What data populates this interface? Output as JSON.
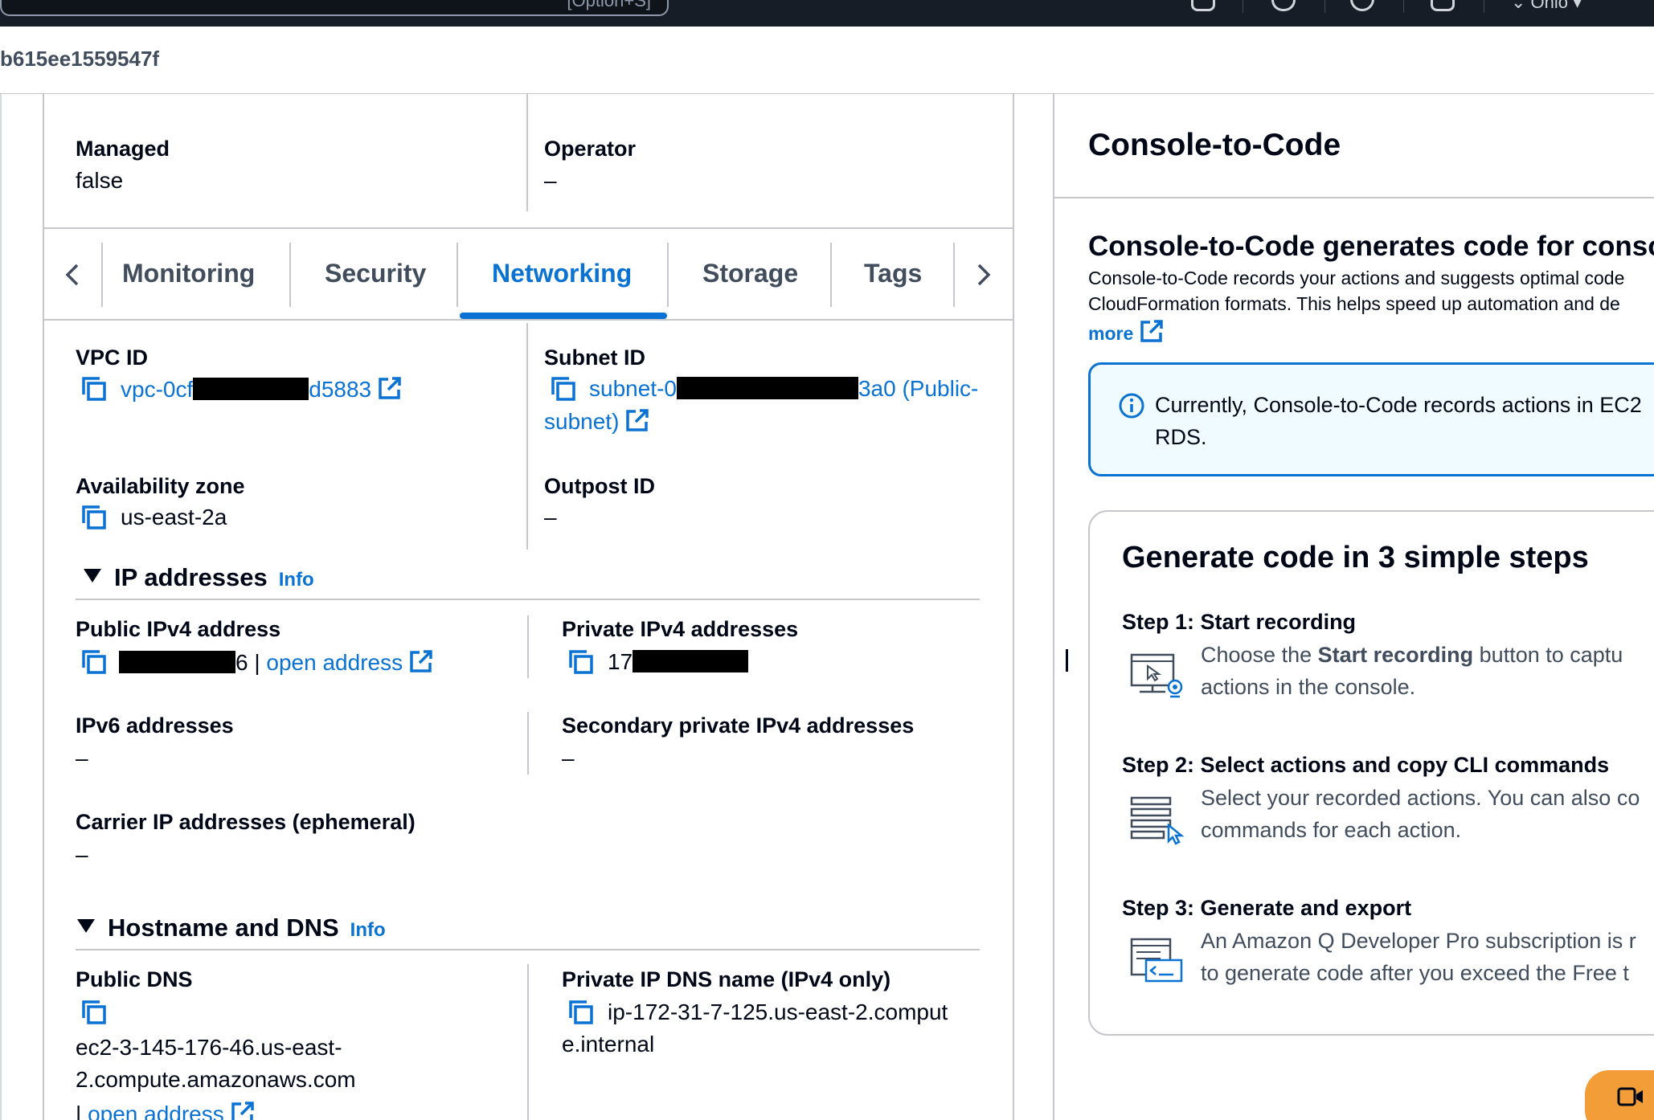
{
  "topbar": {
    "search_hint": "[Option+S]",
    "account_partial": "⌄ Ohio ▾"
  },
  "header": {
    "instance_id_tail": "b615ee1559547f"
  },
  "summary": {
    "managed_label": "Managed",
    "managed_value": "false",
    "operator_label": "Operator",
    "operator_value": "–"
  },
  "tabs": {
    "items": [
      "Monitoring",
      "Security",
      "Networking",
      "Storage",
      "Tags"
    ],
    "active": "Networking"
  },
  "networking": {
    "vpc_label": "VPC ID",
    "vpc_prefix": "vpc-0cf",
    "vpc_suffix": "d5883",
    "subnet_label": "Subnet ID",
    "subnet_prefix": "subnet-0",
    "subnet_suffix": "3a0 (Public-",
    "subnet_line2": "subnet)",
    "az_label": "Availability zone",
    "az_value": "us-east-2a",
    "outpost_label": "Outpost ID",
    "outpost_value": "–"
  },
  "ip_section": {
    "title": "IP addresses",
    "info": "Info",
    "public_ipv4_label": "Public IPv4 address",
    "public_ipv4_suffix": "6 |",
    "open_address": "open address",
    "private_ipv4_label": "Private IPv4 addresses",
    "private_ipv4_prefix": "17",
    "ipv6_label": "IPv6 addresses",
    "ipv6_value": "–",
    "secondary_label": "Secondary private IPv4 addresses",
    "secondary_value": "–",
    "carrier_label": "Carrier IP addresses (ephemeral)",
    "carrier_value": "–"
  },
  "dns_section": {
    "title": "Hostname and DNS",
    "info": "Info",
    "public_dns_label": "Public DNS",
    "public_dns_line1": "ec2-3-145-176-46.us-east-",
    "public_dns_line2": "2.compute.amazonaws.com",
    "public_dns_open": "open address",
    "private_dns_label": "Private IP DNS name (IPv4 only)",
    "private_dns_line1": "ip-172-31-7-125.us-east-2.comput",
    "private_dns_line2": "e.internal"
  },
  "console_to_code": {
    "title": "Console-to-Code",
    "heading": "Console-to-Code generates code for consol",
    "desc_line1": "Console-to-Code records your actions and suggests optimal code",
    "desc_line2": "CloudFormation formats. This helps speed up automation and de",
    "learn_more": "more",
    "info_line1": "Currently, Console-to-Code records actions in EC2",
    "info_line2": "RDS.",
    "card_title": "Generate code in 3 simple steps",
    "step1_title": "Step 1: Start recording",
    "step1_pre": "Choose the ",
    "step1_bold": "Start recording",
    "step1_post": " button to captu",
    "step1_line2": "actions in the console.",
    "step2_title": "Step 2: Select actions and copy CLI commands",
    "step2_line1": "Select your recorded actions. You can also co",
    "step2_line2": "commands for each action.",
    "step3_title": "Step 3: Generate and export",
    "step3_line1": "An Amazon Q Developer Pro subscription is r",
    "step3_line2": "to generate code after you exceed the Free t"
  },
  "colors": {
    "link": "#0972d3",
    "accent": "#f29d38",
    "topbar": "#161d26"
  }
}
